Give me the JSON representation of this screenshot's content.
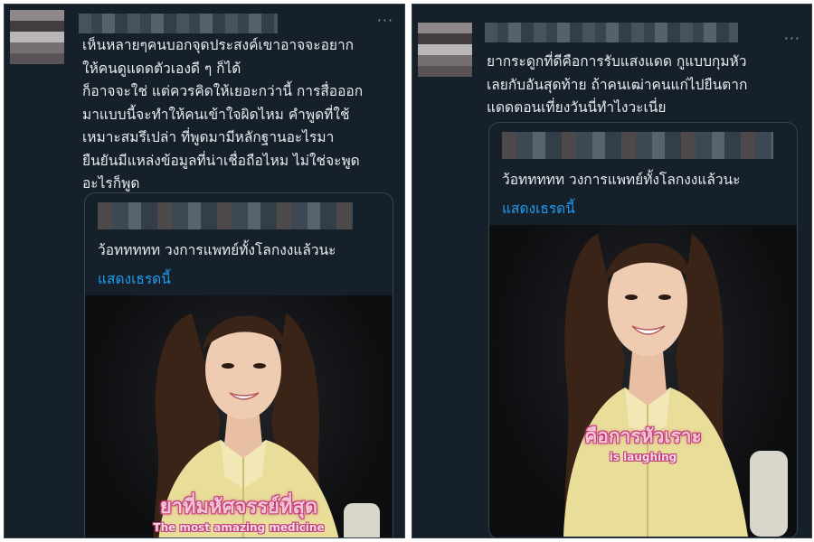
{
  "left_tweet": {
    "more_icon": "···",
    "text": "เห็นหลายๆคนบอกจุดประสงค์เขาอาจจะอยาก\nให้คนดูแดดตัวเองดี ๆ ก็ได้\nก็อาจจะใช่ แต่ควรคิดให้เยอะกว่านี้ การสื่อออก\nมาแบบนี้จะทำให้คนเข้าใจผิดไหม คำพูดที่ใช้\nเหมาะสมรึเปล่า ที่พูดมามีหลักฐานอะไรมา\nยืนยันมีแหล่งข้อมูลที่น่าเชื่อถือไหม ไม่ใช่จะพูด\nอะไรก็พูด",
    "quote": {
      "text": "ว้อททททท วงการแพทย์ทั้งโลกงงแล้วนะ",
      "show_thread": "แสดงเธรดนี้"
    },
    "video": {
      "caption_main": "ยาที่มหัศจรรย์ที่สุด",
      "caption_sub": "The most amazing medicine"
    }
  },
  "right_tweet": {
    "more_icon": "···",
    "text": "ยากระดูกที่ดีคือการรับแสงแดด กูแบบกุมหัว\nเลยกับอันสุดท้าย ถ้าคนเฒ่าคนแก่ไปยืนตาก\nแดดตอนเที่ยงวันนี่ทำไงวะเนี่ย",
    "quote": {
      "text": "ว้อททททท วงการแพทย์ทั้งโลกงงแล้วนะ",
      "show_thread": "แสดงเธรดนี้"
    },
    "video": {
      "caption_main": "คือการหัวเราะ",
      "caption_sub": "is laughing"
    }
  },
  "colors": {
    "background": "#15202b",
    "text": "#e7ecef",
    "link": "#1d9bf0",
    "border": "#38444d",
    "caption": "#f2c4d4",
    "caption_outline": "#c23b76"
  }
}
